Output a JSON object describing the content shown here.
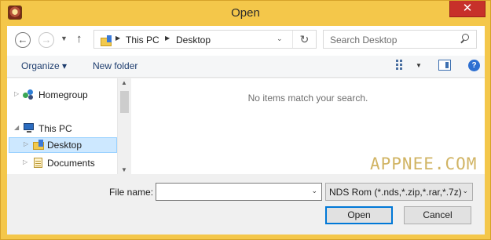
{
  "window": {
    "title": "Open",
    "close_glyph": "✕"
  },
  "nav": {
    "back_glyph": "←",
    "forward_glyph": "→",
    "recent_glyph": "▼",
    "up_glyph": "↑",
    "refresh_glyph": "↻",
    "breadcrumb": [
      {
        "sep": "▶",
        "label": "This PC"
      },
      {
        "sep": "▶",
        "label": "Desktop"
      }
    ],
    "address_dropdown_glyph": "⌄",
    "search_placeholder": "Search Desktop"
  },
  "toolbar": {
    "organize_label": "Organize ▾",
    "new_folder_label": "New folder",
    "view_dropdown_glyph": "▼",
    "help_glyph": "?"
  },
  "tree": {
    "items": [
      {
        "label": "Homegroup",
        "expander": "▷",
        "icon": "homegroup-icon"
      },
      {
        "label": "This PC",
        "expander": "◢",
        "icon": "computer-icon"
      },
      {
        "label": "Desktop",
        "expander": "▷",
        "icon": "desktop-folder-icon",
        "selected": true
      },
      {
        "label": "Documents",
        "expander": "▷",
        "icon": "documents-icon"
      }
    ]
  },
  "content": {
    "empty_message": "No items match your search."
  },
  "scroll": {
    "up_glyph": "▲",
    "down_glyph": "▼"
  },
  "footer": {
    "file_name_label": "File name:",
    "file_name_value": "",
    "file_name_dropdown_glyph": "⌄",
    "file_type_value": "NDS Rom (*.nds,*.zip,*.rar,*.7z)",
    "file_type_dropdown_glyph": "⌄",
    "open_label": "Open",
    "cancel_label": "Cancel"
  },
  "watermark": "APPNEE.COM",
  "colors": {
    "frame": "#f4c74a",
    "close": "#c7302a",
    "selection": "#cde8ff",
    "accent": "#0078d7"
  }
}
